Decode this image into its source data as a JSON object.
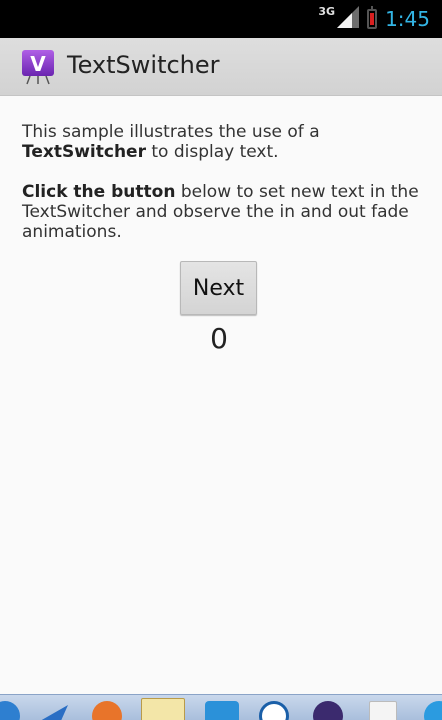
{
  "status_bar": {
    "network_type": "3G",
    "time": "1:45",
    "icons": [
      "signal-icon",
      "battery-low-icon"
    ]
  },
  "action_bar": {
    "title": "TextSwitcher",
    "app_icon": "app-launcher-icon",
    "app_icon_letter": "V"
  },
  "content": {
    "intro_prefix": "This sample illustrates the use of a",
    "intro_bold": "TextSwitcher",
    "intro_suffix": " to display text.",
    "instruction_bold": "Click the button",
    "instruction_rest": " below to set new text in the TextSwitcher and observe the in and out fade animations."
  },
  "button": {
    "label": "Next"
  },
  "switcher": {
    "value": "0"
  },
  "colors": {
    "clock": "#33b5e5",
    "action_bar": "#d6d6d6",
    "background": "#fafafa",
    "battery_low": "#d92020"
  },
  "taskbar": {
    "icons": [
      "ie-icon",
      "visual-studio-icon",
      "firefox-icon",
      "folder-icon",
      "qq-icon",
      "app-k-icon",
      "eclipse-icon",
      "file-icon",
      "browser-icon"
    ]
  }
}
